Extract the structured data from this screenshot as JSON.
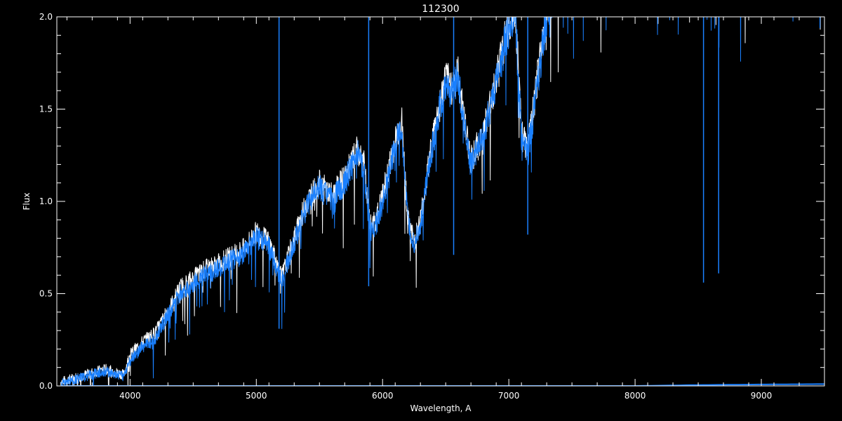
{
  "chart_data": {
    "type": "line",
    "title": "112300",
    "xlabel": "Wavelength, A",
    "ylabel": "Flux",
    "xlim": [
      3420,
      9500
    ],
    "ylim": [
      0,
      2
    ],
    "xticks": [
      4000,
      5000,
      6000,
      7000,
      8000,
      9000
    ],
    "xtick_labels": [
      "4000",
      "5000",
      "6000",
      "7000",
      "8000",
      "9000"
    ],
    "yticks": [
      0,
      0.5,
      1.0,
      1.5,
      2.0
    ],
    "ytick_labels": [
      "0.0",
      "0.5",
      "1.0",
      "1.5",
      "2.0"
    ],
    "grid": false,
    "legend": "none",
    "colors": {
      "background": "#000000",
      "axes": "#ffffff",
      "reference": "#ffffff",
      "observed": "#1a80ff"
    },
    "series": [
      {
        "color": "#ffffff",
        "x": [
          3450,
          3600,
          3700,
          3800,
          3900,
          3950,
          4000,
          4100,
          4200,
          4300,
          4400,
          4500,
          4600,
          4700,
          4800,
          4900,
          5000,
          5100,
          5200,
          5300,
          5400,
          5500,
          5600,
          5700,
          5800,
          5850,
          5900,
          5950,
          6000,
          6100,
          6150,
          6200,
          6250,
          6300,
          6400,
          6500,
          6550,
          6600,
          6650,
          6700,
          6800,
          6900,
          7000,
          7050,
          7100,
          7150,
          7200,
          7300,
          7400,
          7600,
          7800,
          8000,
          8200,
          8400,
          8600,
          8800,
          9000,
          9200,
          9500
        ],
        "y": [
          0.03,
          0.06,
          0.08,
          0.1,
          0.08,
          0.07,
          0.18,
          0.25,
          0.3,
          0.42,
          0.55,
          0.6,
          0.65,
          0.68,
          0.72,
          0.76,
          0.85,
          0.8,
          0.6,
          0.82,
          1.02,
          1.12,
          1.05,
          1.15,
          1.3,
          1.25,
          0.88,
          0.92,
          1.05,
          1.35,
          1.48,
          0.92,
          0.8,
          0.92,
          1.38,
          1.7,
          1.65,
          1.72,
          1.45,
          1.25,
          1.4,
          1.7,
          2.0,
          2.1,
          1.4,
          1.3,
          1.55,
          2.1,
          2.3,
          2.4,
          2.4,
          2.4,
          2.4,
          2.4,
          2.4,
          2.4,
          2.4,
          2.4,
          2.4
        ]
      },
      {
        "color": "#1a80ff",
        "x": [
          3450,
          3600,
          3700,
          3800,
          3900,
          3950,
          4000,
          4100,
          4200,
          4300,
          4400,
          4500,
          4600,
          4700,
          4800,
          4900,
          5000,
          5100,
          5200,
          5300,
          5400,
          5500,
          5600,
          5700,
          5800,
          5850,
          5900,
          5950,
          6000,
          6100,
          6150,
          6200,
          6250,
          6300,
          6400,
          6500,
          6550,
          6600,
          6650,
          6700,
          6800,
          6900,
          7000,
          7050,
          7100,
          7150,
          7200,
          7300,
          7400,
          7600,
          7800,
          8000,
          8200,
          8400,
          8600,
          8800,
          9000,
          9200,
          9500
        ],
        "y": [
          0.02,
          0.05,
          0.07,
          0.09,
          0.07,
          0.06,
          0.15,
          0.22,
          0.27,
          0.4,
          0.52,
          0.57,
          0.62,
          0.65,
          0.7,
          0.73,
          0.82,
          0.78,
          0.58,
          0.79,
          1.0,
          1.1,
          1.02,
          1.13,
          1.28,
          1.22,
          0.86,
          0.9,
          1.02,
          1.32,
          1.45,
          0.9,
          0.78,
          0.9,
          1.35,
          1.68,
          1.62,
          1.7,
          1.42,
          1.22,
          1.38,
          1.68,
          1.98,
          2.05,
          1.38,
          1.28,
          1.52,
          2.05,
          2.3,
          2.4,
          2.4,
          2.4,
          2.4,
          2.4,
          2.4,
          2.4,
          2.4,
          2.4,
          2.4
        ]
      },
      {
        "color": "#1a80ff",
        "x": [
          3450,
          4000,
          4500,
          5000,
          5500,
          6000,
          6500,
          7000,
          7500,
          8000,
          8500,
          9000,
          9500
        ],
        "y": [
          0.0,
          0.0,
          0.0,
          0.0,
          0.0,
          0.0,
          0.0,
          0.0,
          0.0,
          0.0,
          0.005,
          0.008,
          0.01
        ]
      }
    ],
    "absorption_lines": [
      {
        "x": 5180,
        "y": 0.31
      },
      {
        "x": 5890,
        "y": 0.54
      },
      {
        "x": 6563,
        "y": 0.71
      },
      {
        "x": 7150,
        "y": 0.82
      },
      {
        "x": 8542,
        "y": 0.56
      },
      {
        "x": 8662,
        "y": 0.61
      }
    ]
  }
}
